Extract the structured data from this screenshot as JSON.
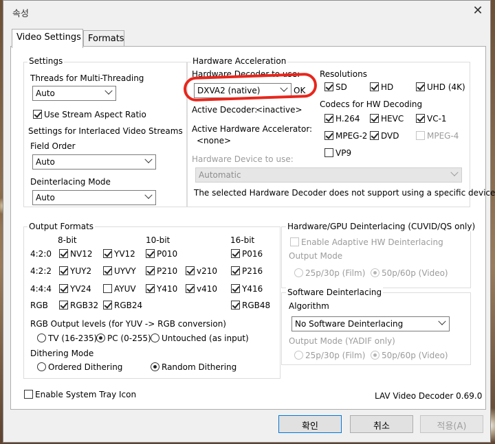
{
  "window": {
    "title": "속성",
    "close_glyph": "✕"
  },
  "tabs": [
    {
      "label": "Video Settings",
      "active": true
    },
    {
      "label": "Formats",
      "active": false
    }
  ],
  "settings": {
    "group_label": "Settings",
    "threads_label": "Threads for Multi-Threading",
    "threads_value": "Auto",
    "stream_aspect_label": "Use Stream Aspect Ratio",
    "stream_aspect_checked": true,
    "interlaced_label": "Settings for Interlaced Video Streams",
    "field_order_label": "Field Order",
    "field_order_value": "Auto",
    "deinterlacing_mode_label": "Deinterlacing Mode",
    "deinterlacing_mode_value": "Auto"
  },
  "hw_accel": {
    "group_label": "Hardware Acceleration",
    "decoder_label": "Hardware Decoder to use:",
    "decoder_value": "DXVA2 (native)",
    "decoder_status": "OK",
    "active_decoder_label": "Active Decoder:",
    "active_decoder_value": "<inactive>",
    "active_accel_label": "Active Hardware Accelerator:",
    "active_accel_value": "<none>",
    "device_label": "Hardware Device to use:",
    "device_value": "Automatic",
    "device_note": "The selected Hardware Decoder does not support using a specific device.",
    "resolutions_label": "Resolutions",
    "resolutions": [
      {
        "label": "SD",
        "checked": true
      },
      {
        "label": "HD",
        "checked": true
      },
      {
        "label": "UHD (4K)",
        "checked": true
      }
    ],
    "codecs_label": "Codecs for HW Decoding",
    "codecs": [
      {
        "label": "H.264",
        "checked": true,
        "enabled": true
      },
      {
        "label": "HEVC",
        "checked": true,
        "enabled": true
      },
      {
        "label": "VC-1",
        "checked": true,
        "enabled": true
      },
      {
        "label": "MPEG-2",
        "checked": true,
        "enabled": true
      },
      {
        "label": "DVD",
        "checked": true,
        "enabled": true
      },
      {
        "label": "MPEG-4",
        "checked": false,
        "enabled": false
      },
      {
        "label": "VP9",
        "checked": false,
        "enabled": true
      }
    ]
  },
  "output": {
    "group_label": "Output Formats",
    "col_8bit": "8-bit",
    "col_10bit": "10-bit",
    "col_16bit": "16-bit",
    "rows": [
      "4:2:0",
      "4:2:2",
      "4:4:4",
      "RGB"
    ],
    "formats": [
      {
        "label": "NV12",
        "checked": true
      },
      {
        "label": "YV12",
        "checked": true
      },
      {
        "label": "P010",
        "checked": true
      },
      {
        "label": "P016",
        "checked": true
      },
      {
        "label": "YUY2",
        "checked": true
      },
      {
        "label": "UYVY",
        "checked": true
      },
      {
        "label": "P210",
        "checked": true
      },
      {
        "label": "v210",
        "checked": true
      },
      {
        "label": "P216",
        "checked": true
      },
      {
        "label": "YV24",
        "checked": true
      },
      {
        "label": "AYUV",
        "checked": false
      },
      {
        "label": "Y410",
        "checked": true
      },
      {
        "label": "v410",
        "checked": true
      },
      {
        "label": "Y416",
        "checked": true
      },
      {
        "label": "RGB32",
        "checked": true
      },
      {
        "label": "RGB24",
        "checked": true
      },
      {
        "label": "RGB48",
        "checked": true
      }
    ],
    "rgb_levels_label": "RGB Output levels (for YUV -> RGB conversion)",
    "rgb_levels": [
      {
        "label": "TV (16-235)",
        "checked": false
      },
      {
        "label": "PC (0-255)",
        "checked": true
      },
      {
        "label": "Untouched (as input)",
        "checked": false
      }
    ],
    "dithering_label": "Dithering Mode",
    "dithering": [
      {
        "label": "Ordered Dithering",
        "checked": false
      },
      {
        "label": "Random Dithering",
        "checked": true
      }
    ]
  },
  "hw_deint": {
    "group_label": "Hardware/GPU Deinterlacing (CUVID/QS only)",
    "adaptive_label": "Enable Adaptive HW Deinterlacing",
    "output_mode_label": "Output Mode",
    "modes": [
      {
        "label": "25p/30p (Film)",
        "checked": false
      },
      {
        "label": "50p/60p (Video)",
        "checked": true
      }
    ]
  },
  "sw_deint": {
    "group_label": "Software Deinterlacing",
    "algorithm_label": "Algorithm",
    "algorithm_value": "No Software Deinterlacing",
    "output_mode_label": "Output Mode (YADIF only)",
    "modes": [
      {
        "label": "25p/30p (Film)",
        "checked": false
      },
      {
        "label": "50p/60p (Video)",
        "checked": true
      }
    ]
  },
  "footer": {
    "tray_label": "Enable System Tray Icon",
    "tray_checked": false,
    "version": "LAV Video Decoder 0.69.0",
    "ok": "확인",
    "cancel": "취소",
    "apply": "적용(A)"
  },
  "colors": {
    "annotation_red": "#e8261c",
    "focus_blue": "#0078d7"
  }
}
